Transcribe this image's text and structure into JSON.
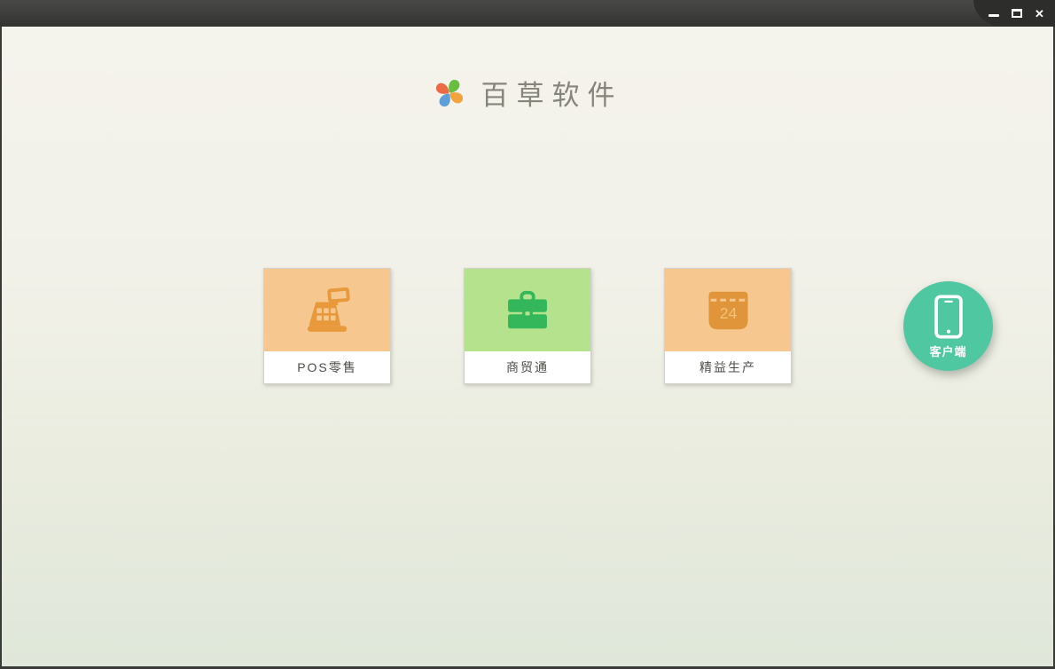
{
  "window": {
    "controls": {
      "close_glyph": "✕"
    }
  },
  "header": {
    "app_name": "百草软件"
  },
  "theme": {
    "titlebar_color": "#3d3d3b",
    "frame_border": "#3a3a38",
    "bg_top": "#f4f3ec",
    "bg_bottom": "#dfe7da",
    "accent_teal": "#4fc8a2"
  },
  "products": [
    {
      "label": "POS零售",
      "icon": "cash-register-icon",
      "tile_color": "#f6c890",
      "icon_color": "#e8993c"
    },
    {
      "label": "商贸通",
      "icon": "briefcase-icon",
      "tile_color": "#b5e38d",
      "icon_color": "#33b75a"
    },
    {
      "label": "精益生产",
      "icon": "calendar-icon",
      "tile_color": "#f6c890",
      "icon_color": "#e0953a",
      "calendar_day": "24"
    }
  ],
  "client_button": {
    "label": "客户端",
    "icon": "smartphone-icon",
    "color": "#4fc8a2"
  }
}
